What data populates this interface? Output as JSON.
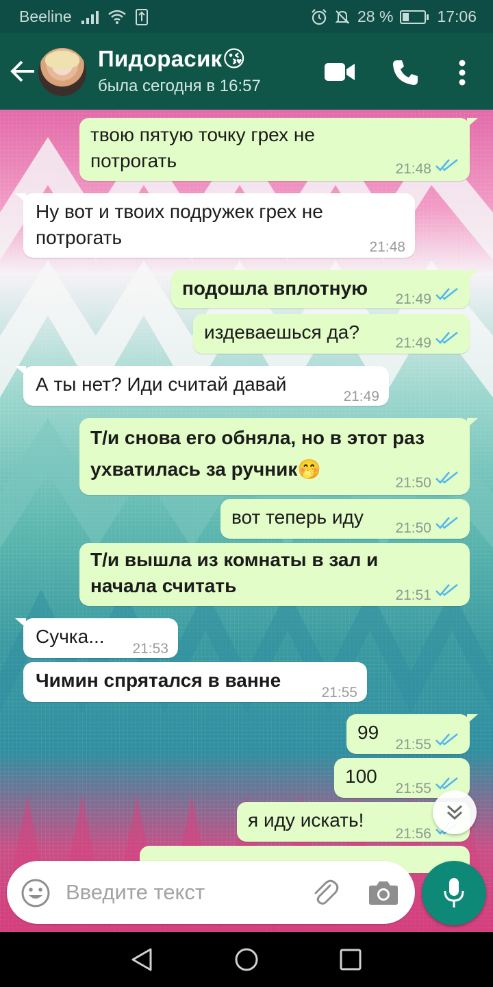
{
  "status_bar": {
    "carrier": "Beeline",
    "battery": "28 %",
    "time": "17:06"
  },
  "header": {
    "contact_name": "Пидорасик😘",
    "last_seen": "была сегодня в 16:57"
  },
  "messages": [
    {
      "dir": "out",
      "line1": "твою пятую точку грех не",
      "line2": "потрогать",
      "time": "21:48",
      "bold": false,
      "read": true
    },
    {
      "dir": "in",
      "line1": "Ну вот и твоих подружек грех не",
      "line2": "потрогать",
      "time": "21:48",
      "bold": false
    },
    {
      "dir": "out",
      "line1": "подошла вплотную",
      "time": "21:49",
      "bold": true,
      "read": true
    },
    {
      "dir": "out",
      "line1": "издеваешься да?",
      "time": "21:49",
      "bold": false,
      "read": true
    },
    {
      "dir": "in",
      "line1": "А ты нет? Иди считай давай",
      "time": "21:49",
      "bold": false
    },
    {
      "dir": "out",
      "line1": "Т/и снова его обняла, но в этот раз",
      "line2": "ухватилась за ручник🤭",
      "time": "21:50",
      "bold": true,
      "read": true
    },
    {
      "dir": "out",
      "line1": "вот теперь иду",
      "time": "21:50",
      "bold": false,
      "read": true
    },
    {
      "dir": "out",
      "line1": "Т/и вышла из комнаты в зал и",
      "line2": "начала считать",
      "time": "21:51",
      "bold": true,
      "read": true
    },
    {
      "dir": "in",
      "line1": "Сучка...",
      "time": "21:53",
      "bold": false
    },
    {
      "dir": "in",
      "line1": "Чимин спрятался в ванне",
      "time": "21:55",
      "bold": true
    },
    {
      "dir": "out",
      "line1": "99",
      "time": "21:55",
      "bold": false,
      "read": true
    },
    {
      "dir": "out",
      "line1": "100",
      "time": "21:55",
      "bold": false,
      "read": true
    },
    {
      "dir": "out",
      "line1": "я иду искать!",
      "time": "21:56",
      "bold": false,
      "read": true
    }
  ],
  "composer": {
    "placeholder": "Введите текст"
  },
  "icons": {
    "back": "arrow-left-icon",
    "video": "video-call-icon",
    "call": "phone-icon",
    "menu": "more-vert-icon",
    "emoji": "emoji-icon",
    "attach": "paperclip-icon",
    "camera": "camera-icon",
    "mic": "mic-icon",
    "scroll": "double-chevron-down-icon"
  },
  "colors": {
    "header": "#0f5548",
    "outgoing_bubble": "#e2fdc8",
    "incoming_bubble": "#ffffff",
    "read_ticks": "#4fb6ec",
    "mic_button": "#0e8877"
  }
}
